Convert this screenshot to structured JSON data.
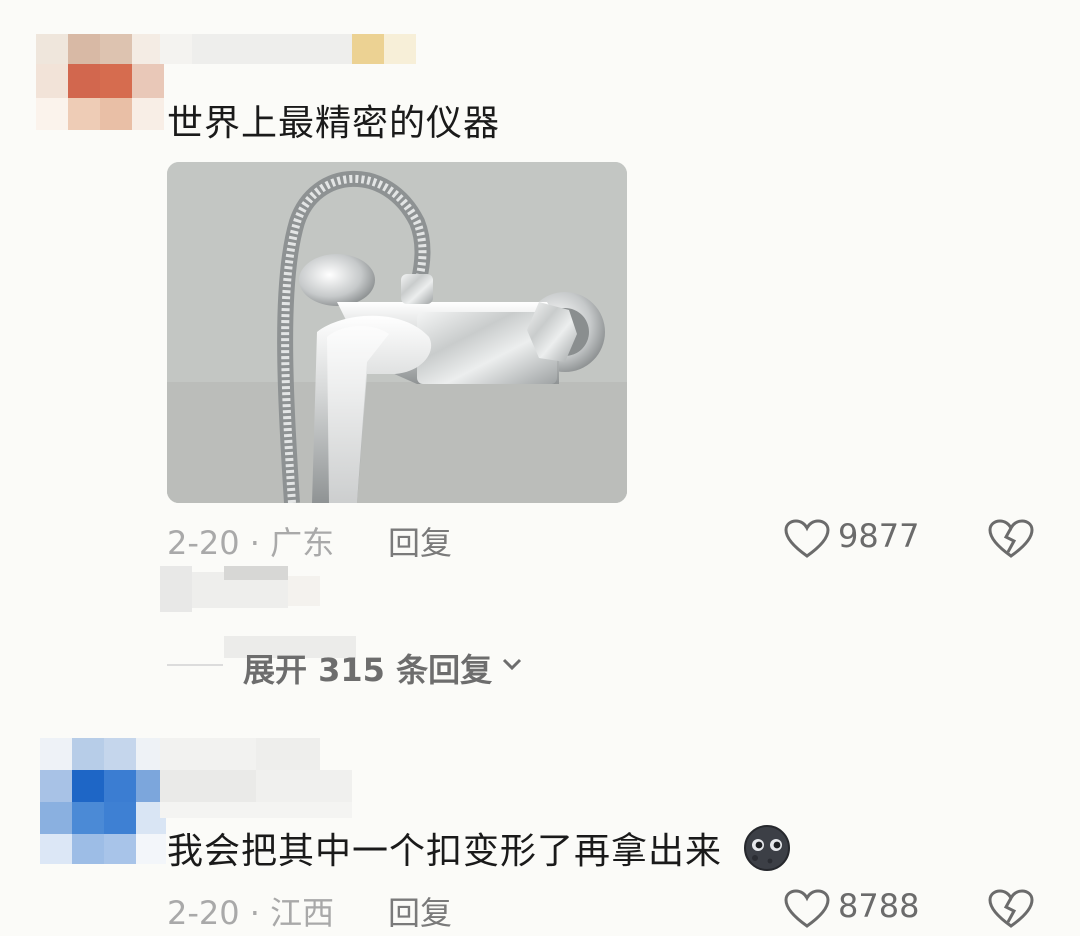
{
  "comments": [
    {
      "text": "世界上最精密的仪器",
      "date_location": "2-20 · 广东",
      "reply_label": "回复",
      "likes": "9877",
      "image_alt": "faucet"
    },
    {
      "text": "我会把其中一个扣变形了再拿出来",
      "emoji": "🌚",
      "date_location": "2-20 · 江西",
      "reply_label": "回复",
      "likes": "8788"
    }
  ],
  "sub_reply": {
    "expand_label": "展开 315 条回复"
  },
  "icons": {
    "like": "heart-outline-icon",
    "dislike": "broken-heart-icon",
    "expand": "chevron-down-icon"
  },
  "colors": {
    "background": "#fbfbf8",
    "meta_text": "#a9a9a9"
  }
}
